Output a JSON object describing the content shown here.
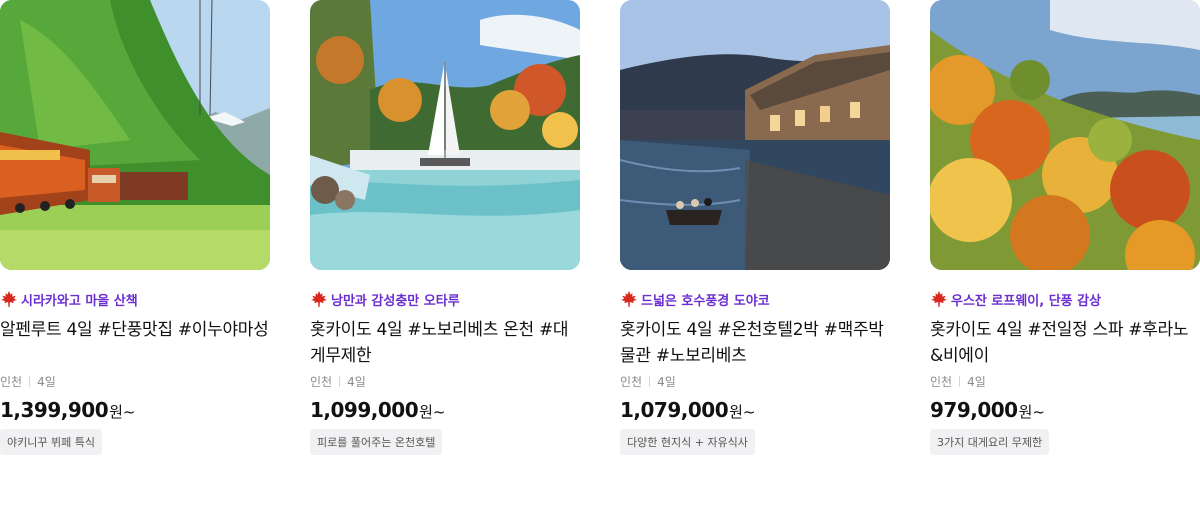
{
  "products": [
    {
      "tagline": "시라카와고 마을 산책",
      "title": "알펜루트 4일 #단풍맛집 #이누야마성",
      "departure": "인천",
      "duration": "4일",
      "price": "1,399,900",
      "price_unit": "원~",
      "badge": "야키니꾸 뷔페 특식",
      "image_subject": "mountain-railway-train"
    },
    {
      "tagline": "낭만과 감성충만 오타루",
      "title": "홋카이도 4일 #노보리베츠 온천 #대게무제한",
      "departure": "인천",
      "duration": "4일",
      "price": "1,099,000",
      "price_unit": "원~",
      "badge": "피로를 풀어주는 온천호텔",
      "image_subject": "sailboat-pool-autumn-trees"
    },
    {
      "tagline": "드넓은 호수풍경 도야코",
      "title": "홋카이도 4일 #온천호텔2박 #맥주박물관 #노보리베츠",
      "departure": "인천",
      "duration": "4일",
      "price": "1,079,000",
      "price_unit": "원~",
      "badge": "다양한 현지식 + 자유식사",
      "image_subject": "otaru-canal-boat"
    },
    {
      "tagline": "우스잔 로프웨이, 단풍 감상",
      "title": "홋카이도 4일 #전일정 스파 #후라노&비에이",
      "departure": "인천",
      "duration": "4일",
      "price": "979,000",
      "price_unit": "원~",
      "badge": "3가지 대게요리 무제한",
      "image_subject": "autumn-forest-lake-view"
    }
  ],
  "colors": {
    "tagline": "#6b2fd1",
    "maple": "#d8281d",
    "badge_bg": "#f1f1f3"
  },
  "icons": {
    "tagline_icon": "maple-leaf-icon"
  }
}
